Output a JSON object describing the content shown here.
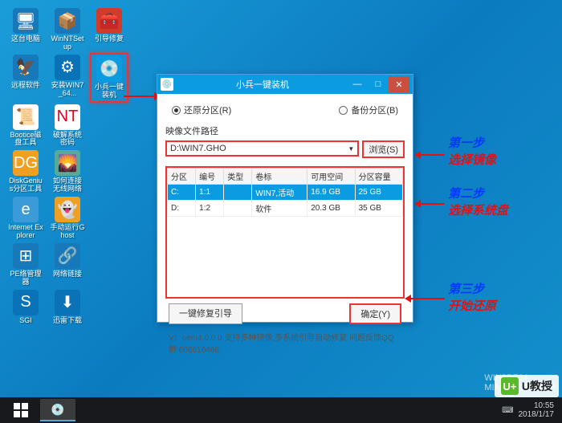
{
  "desktop_icons": [
    [
      {
        "label": "这台电脑",
        "glyph": "🖥",
        "bg": "#1779ba"
      },
      {
        "label": "WinNTSetup",
        "glyph": "📦",
        "bg": "#1779ba"
      },
      {
        "label": "引导修复",
        "glyph": "🧰",
        "bg": "#d03c2a"
      }
    ],
    [
      {
        "label": "远程软件",
        "glyph": "🦅",
        "bg": "#1779ba"
      },
      {
        "label": "安装WIN7_64...",
        "glyph": "⚙",
        "bg": "#0a73b7"
      },
      {
        "label": "小兵一键装机",
        "glyph": "💿",
        "bg": "#0a9be0",
        "hl": true
      }
    ],
    [
      {
        "label": "Bootice磁盘工具",
        "glyph": "📜",
        "bg": "#fff"
      },
      {
        "label": "破解系统密码",
        "glyph": "NT",
        "bg": "#fff",
        "color": "#d02"
      }
    ],
    [
      {
        "label": "DiskGenius分区工具",
        "glyph": "DG",
        "bg": "#f0a020"
      },
      {
        "label": "如何连接无线网络",
        "glyph": "🌄",
        "bg": "#5a9"
      }
    ],
    [
      {
        "label": "Internet Explorer",
        "glyph": "e",
        "bg": "#3b9bd9"
      },
      {
        "label": "手动运行Ghost",
        "glyph": "👻",
        "bg": "#f0a020"
      }
    ],
    [
      {
        "label": "PE络管理器",
        "glyph": "⊞",
        "bg": "#1779ba"
      },
      {
        "label": "网络链接",
        "glyph": "🔗",
        "bg": "#1779ba"
      }
    ],
    [
      {
        "label": "SGI",
        "glyph": "S",
        "bg": "#0a73b7"
      },
      {
        "label": "迅雷下载",
        "glyph": "⬇",
        "bg": "#0a73b7"
      }
    ]
  ],
  "window": {
    "title": "小兵一键装机",
    "radio_restore": "还原分区(R)",
    "radio_backup": "备份分区(B)",
    "path_label": "映像文件路径",
    "path_value": "D:\\WIN7.GHO",
    "browse": "浏览(S)",
    "cols": [
      "分区",
      "编号",
      "类型",
      "卷标",
      "可用空间",
      "分区容量"
    ],
    "rows": [
      {
        "p": "C:",
        "n": "1:1",
        "t": "",
        "v": "WIN7,活动",
        "f": "16.9 GB",
        "s": "25 GB",
        "sel": true
      },
      {
        "p": "D:",
        "n": "1:2",
        "t": "",
        "v": "软件",
        "f": "20.3 GB",
        "s": "35 GB",
        "sel": false
      }
    ],
    "boot_fix": "一键修复引导",
    "ok": "确定(Y)",
    "footer": "V：oem4.0.0.0    支持多种镜像,多系统引导自动修复 问题反馈QQ群:606616468"
  },
  "annotations": {
    "s1": "第一步",
    "a1": "选择镜像",
    "s2": "第二步",
    "a2": "选择系统盘",
    "s3": "第三步",
    "a3": "开始还原"
  },
  "taskbar": {
    "time": "10:55",
    "date": "2018/1/17",
    "wm_host": "WIN8PE64",
    "wm_url": "MIAOSHOU.COM"
  },
  "logo": "U教授"
}
